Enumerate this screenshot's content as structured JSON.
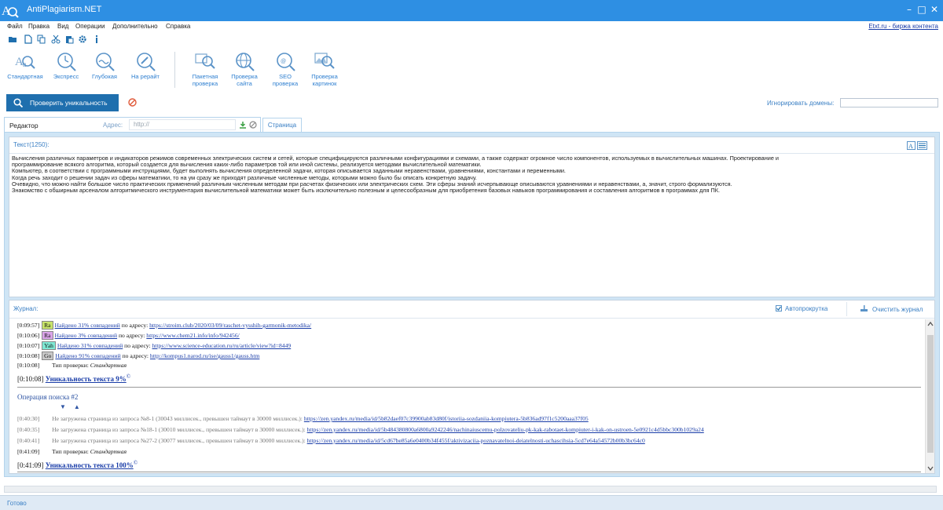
{
  "window": {
    "title": "AntiPlagiarism.NET"
  },
  "menu": {
    "items": [
      "Файл",
      "Правка",
      "Вид",
      "Операции",
      "Дополнительно",
      "Справка"
    ],
    "right_link": "Etxt.ru - биржа контента"
  },
  "small_toolbar": {
    "icons": [
      "open-folder-icon",
      "new-document-icon",
      "copy-icon",
      "cut-icon",
      "paste-icon",
      "settings-icon",
      "info-icon"
    ]
  },
  "toolbar": {
    "buttons": [
      {
        "label": "Стандартная",
        "icon": "standard-check-icon"
      },
      {
        "label": "Экспресс",
        "icon": "express-check-icon"
      },
      {
        "label": "Глубокая",
        "icon": "deep-check-icon"
      },
      {
        "label": "На рерайт",
        "icon": "rewrite-check-icon"
      },
      {
        "label1": "Пакетная",
        "label2": "проверка",
        "icon": "batch-check-icon"
      },
      {
        "label1": "Проверка",
        "label2": "сайта",
        "icon": "site-check-icon"
      },
      {
        "label1": "SEO",
        "label2": "проверка",
        "icon": "seo-check-icon"
      },
      {
        "label1": "Проверка",
        "label2": "картинок",
        "icon": "image-check-icon"
      }
    ]
  },
  "check": {
    "button_label": "Проверить уникальность",
    "ignore_label": "Игнорировать домены:",
    "ignore_value": ""
  },
  "editor": {
    "tab_label": "Редактор",
    "address_label": "Адрес:",
    "address_placeholder": "http://",
    "page_tab_label": "Страница",
    "header": "Текст(1250):",
    "lines": [
      "Вычисления различных параметров и индикаторов режимов современных электрических систем и сетей, которые специфицируются различными конфигурациями и схемами,  а также содержат огромное число компонентов, используемых в вычислительных машинах. Проектирование и",
      "программирование всякого алгоритма, который создается для вычисления каких-либо параметров той или иной системы, реализуется методами вычислительной математики.",
      "Компьютер, в соответствии с программными инструкциями, будет выполнять вычисления определенной задачи, которая описывается заданными неравенствами, уравнениями, константами и переменными.",
      "Когда речь заходит о решении задач из сферы математики, то на ум сразу же приходят различные численные методы, которыми можно было бы описать конкретную задачу.",
      "Очевидно, что можно найти большое число практических применений различным численным методам при расчетах физических или электрических схем. Эти сферы  знаний исчерпывающе описываются уравнениями и неравенствами, а, значит, строго формализуются.",
      "Знакомство с обширным арсеналом алгоритмического инструментария вычислительной математики может быть исключительно полезным и целесообразным для приобретения базовых навыков программирования и составления алгоритмов в программах для ПК."
    ]
  },
  "journal": {
    "header": "Журнал:",
    "autoscroll_label": "Автопрокрутка",
    "clear_label": "Очистить журнал",
    "entries": [
      {
        "time": "[0:09:57]",
        "badge": "Ra",
        "badge_color": "#c7e36a",
        "found": "Найдено 31% совпадений",
        "by": " по адресу: ",
        "url": "https://stroim.club/2020/03/09/raschet-vysshih-garmonik-metodika/"
      },
      {
        "time": "[0:10:06]",
        "badge": "Ra",
        "badge_color": "#d9a4e8",
        "found": "Найдено 3% совпадений",
        "by": " по адресу: ",
        "url": "https://www.chem21.info/info/942456/"
      },
      {
        "time": "[0:10:07]",
        "badge": "Yah",
        "badge_color": "#7ee8d4",
        "found": "Найдено 31% совпадений",
        "by": " по адресу: ",
        "url": "https://www.science-education.ru/ru/article/view?id=8449"
      },
      {
        "time": "[0:10:08]",
        "badge": "Go",
        "badge_color": "#c9c9c9",
        "found": "Найдено 91% совпадений",
        "by": " по адресу: ",
        "url": "http://kompus1.narod.ru/ise/gauss1/gauss.htm"
      }
    ],
    "type1": {
      "time": "[0:10:08]",
      "label": "Тип проверки:",
      "value": "Стандартная"
    },
    "result1": {
      "time": "[0:10:08]",
      "text": "Уникальность текста 9%",
      "mark": "©"
    },
    "operation_header": "Операция поиска #2",
    "arrows": "▼ ▲",
    "errors": [
      {
        "time": "[0:40:30]",
        "text": "Не загружена страница из запроса №8-1 (30043 миллисек., превышен таймаут в 30000 миллисек.):",
        "url": "https://zen.yandex.ru/media/id/5b82daef07c39900ab83d80f/istoriia-sozdaniia-kompiutera-5b836ad97f1c5200aaa37f05"
      },
      {
        "time": "[0:40:35]",
        "text": "Не загружена страница из запроса №18-1 (30010 миллисек., превышен таймаут в 30000 миллисек.):",
        "url": "https://zen.yandex.ru/media/id/5b484380800a6800a9242246/nachinaiuscemu-polzovateliu-pk-kak-rabotaet-kompiuter-i-kak-on-ustroen-5e0921c4d5bbc300b1029a24"
      },
      {
        "time": "[0:40:41]",
        "text": "Не загружена страница из запроса №27-2 (30077 миллисек., превышен таймаут в 30000 миллисек.):",
        "url": "https://zen.yandex.ru/media/id/5cd67be85a6e0400b34f455f/aktivizaciia-poznavatelnoi-deiatelnosti-uchascihsia-5cd7e64a54572b00b3bc64c0"
      }
    ],
    "type2": {
      "time": "[0:41:09]",
      "label": "Тип проверки:",
      "value": "Стандартная"
    },
    "result2": {
      "time": "[0:41:09]",
      "text": "Уникальность текста 100%",
      "mark": "©"
    }
  },
  "status": {
    "text": "Готово"
  },
  "colors": {
    "titlebar": "#2e8fe3",
    "accent": "#1f6fae",
    "link": "#1a3da8"
  }
}
